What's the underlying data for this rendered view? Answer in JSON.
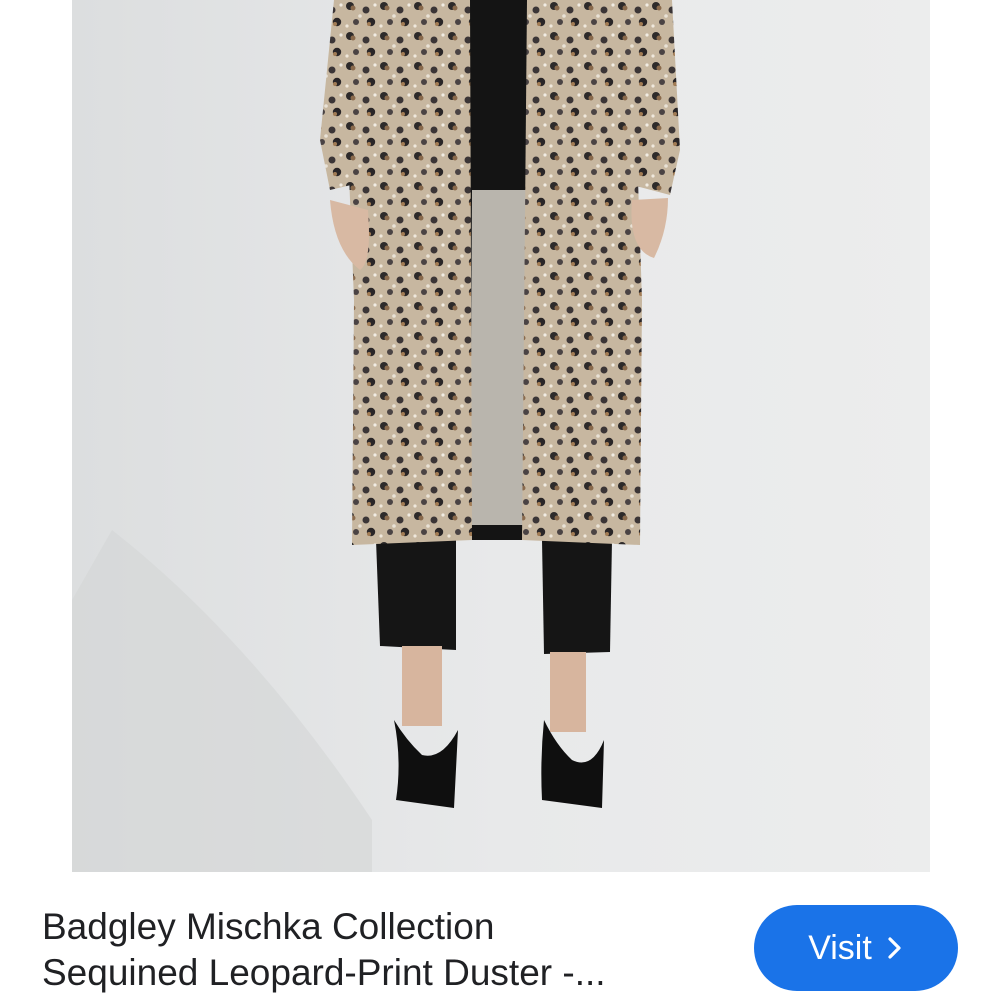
{
  "result": {
    "image_alt": "Model wearing sequined leopard-print duster over black cropped pants and black pumps",
    "title_line1": "Badgley Mischka Collection",
    "title_line2": "Sequined Leopard-Print Duster -..."
  },
  "action": {
    "visit_label": "Visit",
    "visit_icon": "chevron-right-icon",
    "accent_color": "#1a73e8"
  }
}
